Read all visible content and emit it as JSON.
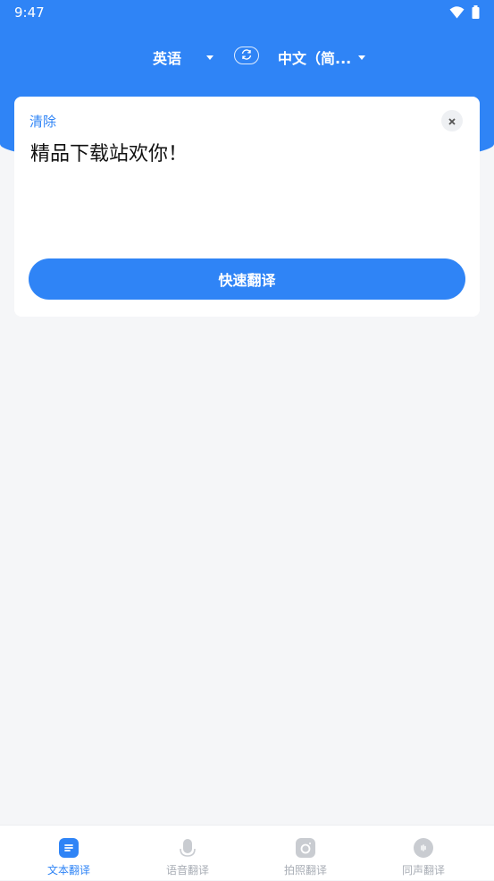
{
  "status": {
    "time": "9:47"
  },
  "lang": {
    "source": "英语",
    "target": "中文（简..."
  },
  "card": {
    "clear_label": "清除",
    "input_text": "精品下载站欢你！",
    "translate_button": "快速翻译"
  },
  "tabs": [
    {
      "label": "文本翻译",
      "icon": "text-document-icon",
      "active": true
    },
    {
      "label": "语音翻译",
      "icon": "microphone-icon",
      "active": false
    },
    {
      "label": "拍照翻译",
      "icon": "camera-icon",
      "active": false
    },
    {
      "label": "同声翻译",
      "icon": "chat-bubble-icon",
      "active": false
    }
  ],
  "colors": {
    "primary": "#2f84f6",
    "background": "#f5f6f8",
    "inactive": "#a8adb5"
  }
}
